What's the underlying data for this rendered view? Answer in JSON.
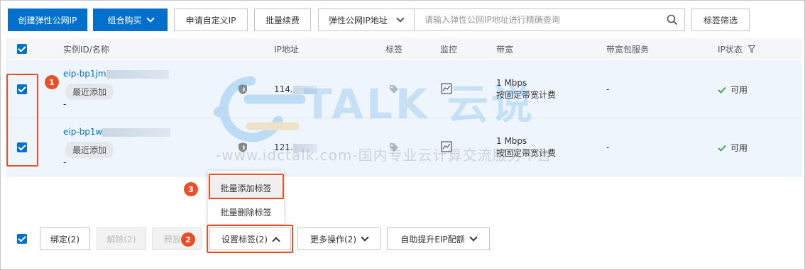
{
  "toolbar": {
    "create_label": "创建弹性公网IP",
    "bundle_label": "组合购买",
    "apply_custom_ip_label": "申请自定义IP",
    "batch_renew_label": "批量续费",
    "search_type_label": "弹性公网IP地址",
    "search_placeholder": "请输入弹性公网IP地址进行精确查询",
    "tag_filter_label": "标签筛选"
  },
  "table": {
    "headers": {
      "instance": "实例ID/名称",
      "ip": "IP地址",
      "tag": "标签",
      "monitor": "监控",
      "bandwidth": "带宽",
      "bandwidth_package": "带宽包服务",
      "ip_status": "IP状态"
    },
    "rows": [
      {
        "id": "eip-bp1jm",
        "tag_label": "最近添加",
        "name": "-",
        "ip": "114.",
        "bandwidth": "1 Mbps",
        "billing": "按固定带宽计费",
        "bandwidth_package": "-",
        "status": "可用"
      },
      {
        "id": "eip-bp1w",
        "tag_label": "最近添加",
        "name": "-",
        "ip": "121.",
        "bandwidth": "1 Mbps",
        "billing": "按固定带宽计费",
        "bandwidth_package": "-",
        "status": "可用"
      }
    ]
  },
  "dropdown": {
    "items": [
      "批量添加标签",
      "批量删除标签"
    ]
  },
  "bottom_bar": {
    "bind_label": "绑定(2)",
    "unbind_label": "解除(2)",
    "release_label": "释放",
    "set_tags_label": "设置标签(2)",
    "more_actions_label": "更多操作(2)",
    "quota_label": "自助提升EIP配额"
  },
  "annotations": {
    "badge_1": "1",
    "badge_2": "2",
    "badge_3": "3"
  },
  "watermark": {
    "logo_text": "TALK 云说",
    "tagline": "-www.idctalk.com-国内专业云计算交流服务平台-"
  },
  "colors": {
    "primary": "#0070cc",
    "highlight": "#e8502a",
    "row_selected": "#eef5fc",
    "success": "#2e9f3e"
  },
  "icons": [
    "chevron-down-icon",
    "search-icon",
    "filter-icon",
    "shield-icon",
    "tag-icon",
    "monitor-chart-icon",
    "check-icon",
    "chevron-up-icon"
  ]
}
